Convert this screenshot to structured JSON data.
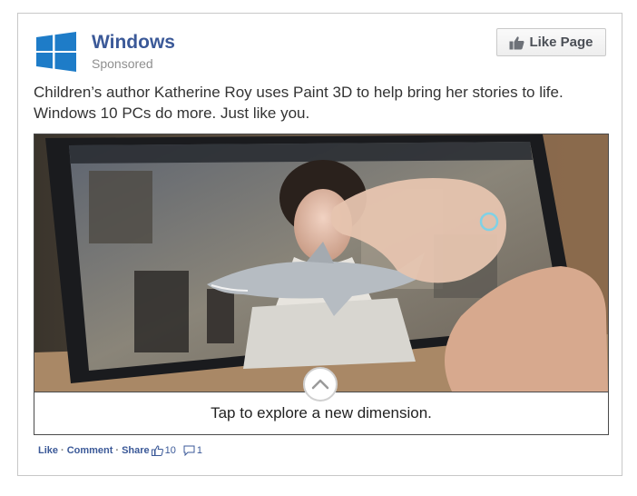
{
  "post": {
    "page_name": "Windows",
    "sponsored_label": "Sponsored",
    "like_page_label": "Like Page",
    "text_line1": "Children’s author Katherine Roy uses Paint 3D to help bring her stories to life.",
    "text_line2": "Windows 10 PCs do more. Just like you.",
    "media": {
      "caption": "Tap to explore a new dimension.",
      "expand_icon": "chevron-up-icon"
    },
    "actions": {
      "like_label": "Like",
      "comment_label": "Comment",
      "share_label": "Share",
      "separator": "·",
      "like_count": "10",
      "comment_count": "1"
    }
  },
  "colors": {
    "brand_blue": "#3b5998",
    "windows_logo": "#1e7cc8"
  }
}
